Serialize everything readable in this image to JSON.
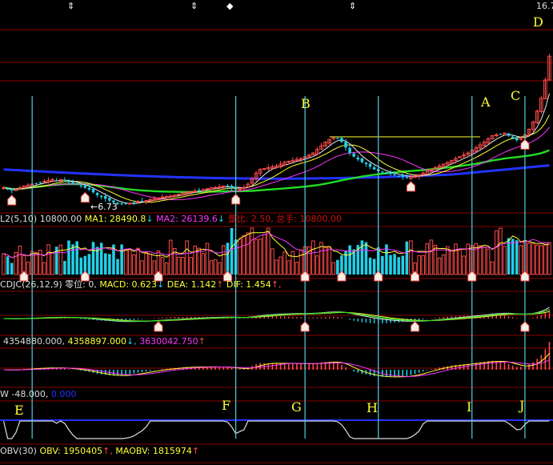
{
  "top_right_value": "16.7",
  "colors": {
    "up": "#ff4a4a",
    "down": "#22d0e8",
    "ma_fast": "#e8e8e8",
    "ma_mid": "#ffff33",
    "ma_pink": "#ff33ff",
    "ma_green": "#22dd22",
    "ma_blue": "#2233ff",
    "grid": "#8b0000",
    "marker": "#4fd0e0",
    "resistance": "#bbbb22"
  },
  "panels": {
    "volume": {
      "name": "L2(5,10)",
      "value": "10800.00",
      "ma1": "MA1: 28490.8",
      "ma1_arrow": "↓",
      "ma2": "MA2: 26139.6",
      "ma2_arrow": "↓",
      "extra": "量比: 2.50, 总手: 10800.00"
    },
    "macd": {
      "name": "CDJC(26,12,9)",
      "zero": "零位: 0,",
      "macd": "MACD: 0.623",
      "macd_arrow": "↓",
      "dea": "DEA: 1.142",
      "dea_arrow": "↑",
      "dif": "DIF: 1.454",
      "dif_arrow": "↑,"
    },
    "osc": {
      "v1": "4354880.000,",
      "v2": "4358897.000",
      "v2_arrow": "↓,",
      "v3": "3630042.750",
      "v3_arrow": "↑"
    },
    "w": {
      "name": "W",
      "v1": "-48.000,",
      "v2": "0.000"
    },
    "obv": {
      "name": "OBV(30)",
      "obv": "OBV: 1950405",
      "obv_arrow": "↑,",
      "maobv": "MAOBV: 1815974",
      "maobv_arrow": "↑"
    }
  },
  "annotations": {
    "low_price": "6.73",
    "letters": [
      "A",
      "B",
      "C",
      "D",
      "E",
      "F",
      "G",
      "H",
      "I",
      "J"
    ]
  },
  "chart_data": {
    "type": "candlestick",
    "price_close": [
      5.6,
      5.55,
      5.45,
      5.5,
      5.6,
      5.7,
      5.75,
      5.8,
      5.85,
      5.9,
      5.95,
      6.0,
      6.05,
      5.98,
      6.05,
      6.0,
      5.9,
      5.85,
      5.78,
      5.7,
      5.6,
      5.5,
      5.35,
      5.2,
      5.1,
      5.0,
      4.9,
      4.8,
      4.72,
      4.7,
      4.72,
      4.75,
      4.8,
      4.85,
      4.88,
      4.9,
      4.95,
      5.0,
      5.05,
      5.1,
      5.12,
      5.15,
      5.2,
      5.25,
      5.3,
      5.35,
      5.4,
      5.42,
      5.45,
      5.5,
      5.55,
      5.6,
      5.62,
      5.65,
      5.7,
      5.68,
      5.6,
      5.5,
      5.55,
      5.6,
      5.8,
      6.1,
      6.4,
      6.6,
      6.65,
      6.7,
      6.75,
      6.8,
      6.9,
      7.0,
      7.05,
      7.1,
      7.15,
      7.2,
      7.3,
      7.4,
      7.5,
      7.7,
      7.9,
      8.1,
      8.25,
      8.35,
      8.3,
      8.1,
      7.8,
      7.5,
      7.3,
      7.15,
      7.0,
      6.9,
      6.75,
      6.6,
      6.5,
      6.45,
      6.4,
      6.35,
      6.3,
      6.25,
      6.2,
      6.15,
      6.2,
      6.25,
      6.3,
      6.4,
      6.5,
      6.6,
      6.7,
      6.8,
      6.9,
      7.0,
      7.1,
      7.2,
      7.3,
      7.4,
      7.5,
      7.65,
      7.8,
      7.95,
      8.1,
      8.3,
      8.45,
      8.5,
      8.55,
      8.6,
      8.45,
      8.3,
      8.2,
      8.3,
      8.5,
      8.8,
      9.2,
      9.8,
      10.5,
      11.5,
      12.8
    ],
    "low_marked": 6.73,
    "ylim": [
      4.4,
      15
    ],
    "letter_marks": [
      {
        "label": "B",
        "bar": 82
      },
      {
        "label": "A",
        "bar": 117
      },
      {
        "label": "C",
        "bar": 124
      },
      {
        "label": "D",
        "bar": 130
      },
      {
        "label": "E",
        "bar": 7
      },
      {
        "label": "F",
        "bar": 57
      },
      {
        "label": "G",
        "bar": 74
      },
      {
        "label": "H",
        "bar": 92
      },
      {
        "label": "I",
        "bar": 115
      },
      {
        "label": "J",
        "bar": 128
      }
    ],
    "vertical_marker_bars": [
      7,
      57,
      74,
      92,
      115,
      128
    ],
    "resistance_level": 8.3,
    "series": [
      {
        "name": "MA1",
        "value": 28490.8
      },
      {
        "name": "MA2",
        "value": 26139.6
      },
      {
        "name": "MACD",
        "value": 0.623
      },
      {
        "name": "DEA",
        "value": 1.142
      },
      {
        "name": "DIF",
        "value": 1.454
      },
      {
        "name": "OBV",
        "value": 1950405
      },
      {
        "name": "MAOBV",
        "value": 1815974
      }
    ]
  }
}
